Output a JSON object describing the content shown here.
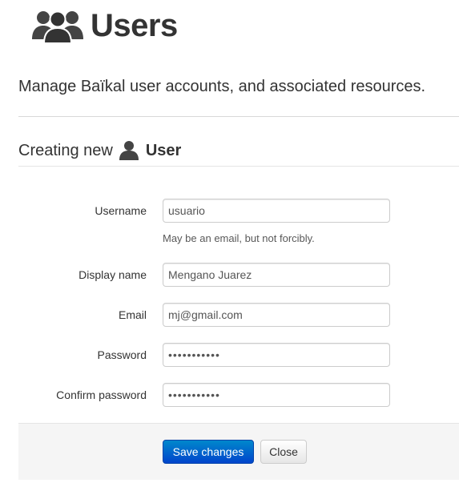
{
  "header": {
    "icon": "users-icon",
    "title": "Users"
  },
  "lead": "Manage Baïkal user accounts, and associated resources.",
  "section": {
    "prefix": "Creating new",
    "icon": "user-icon",
    "title": "User"
  },
  "form": {
    "username": {
      "label": "Username",
      "value": "usuario",
      "help": "May be an email, but not forcibly."
    },
    "display_name": {
      "label": "Display name",
      "value": "Mengano Juarez"
    },
    "email": {
      "label": "Email",
      "value": "mj@gmail.com"
    },
    "password": {
      "label": "Password",
      "value": "•••••••••••"
    },
    "confirm_password": {
      "label": "Confirm password",
      "value": "•••••••••••"
    }
  },
  "actions": {
    "save_label": "Save changes",
    "close_label": "Close"
  },
  "colors": {
    "primary": "#0055cc",
    "text": "#333333",
    "actions_bg": "#f5f5f5"
  }
}
